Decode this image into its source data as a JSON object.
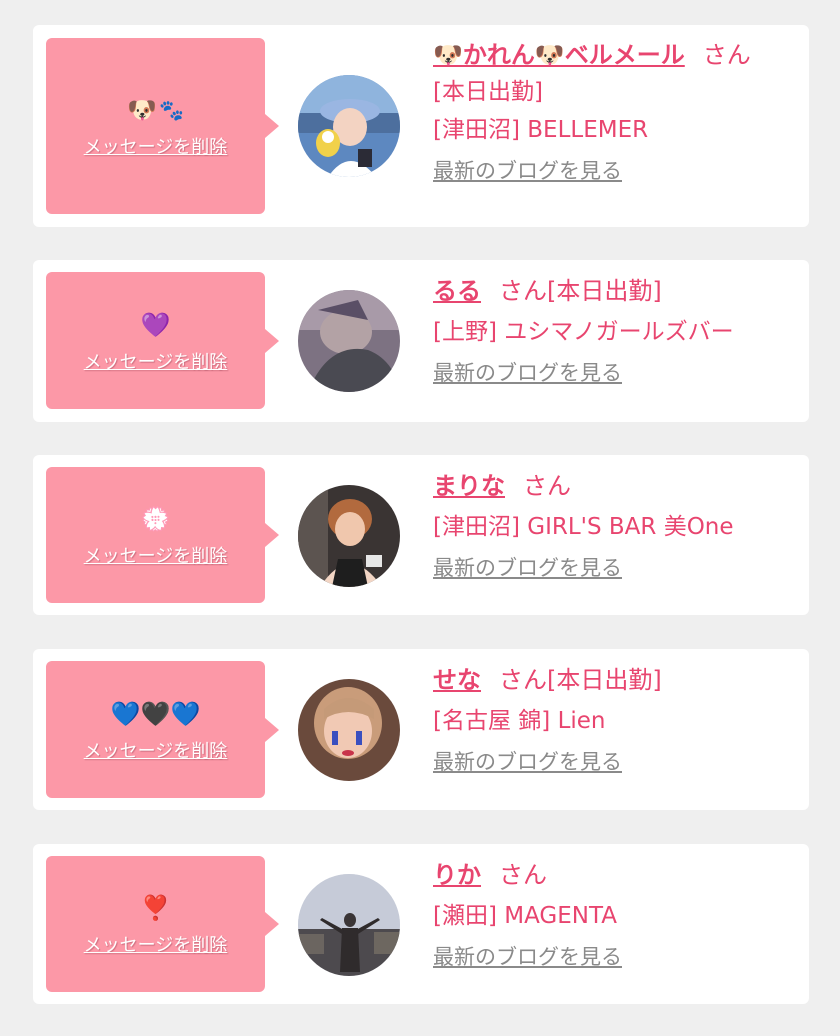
{
  "items": [
    {
      "emoji": "🐶🐾",
      "delete_label": "メッセージを削除",
      "name": "🐶かれん🐶ベルメール",
      "san": "さん",
      "status_inline": "",
      "status_line": "[本日出勤]",
      "shop": "[津田沼] BELLEMER",
      "blog_label": "最新のブログを見る"
    },
    {
      "emoji": "💜",
      "delete_label": "メッセージを削除",
      "name": "るる",
      "san": "さん",
      "status_inline": "[本日出勤]",
      "status_line": "",
      "shop": "[上野] ユシマノガールズバー",
      "blog_label": "最新のブログを見る"
    },
    {
      "emoji": "💮",
      "delete_label": "メッセージを削除",
      "name": "まりな",
      "san": "さん",
      "status_inline": "",
      "status_line": "",
      "shop": "[津田沼] GIRL'S BAR 美One",
      "blog_label": "最新のブログを見る"
    },
    {
      "emoji": "💙🖤💙",
      "delete_label": "メッセージを削除",
      "name": "せな",
      "san": "さん",
      "status_inline": "[本日出勤]",
      "status_line": "",
      "shop": "[名古屋 錦] Lien",
      "blog_label": "最新のブログを見る"
    },
    {
      "emoji": "❣️",
      "delete_label": "メッセージを削除",
      "name": "りか",
      "san": "さん",
      "status_inline": "",
      "status_line": "",
      "shop": "[瀬田] MAGENTA",
      "blog_label": "最新のブログを見る"
    }
  ],
  "colors": {
    "accent": "#e8456f",
    "delete_panel": "#fc98a7",
    "link_gray": "#8a8a8a",
    "background": "#efefef"
  }
}
